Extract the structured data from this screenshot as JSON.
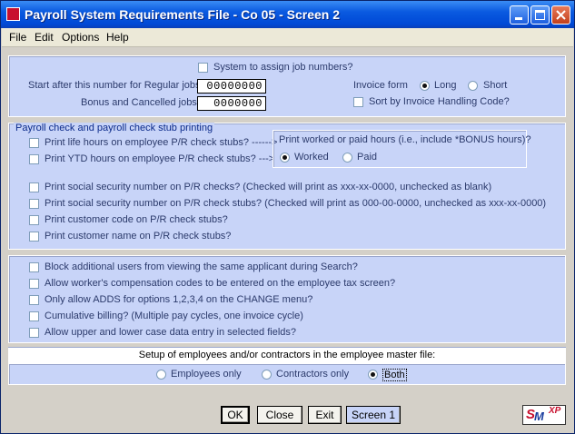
{
  "window": {
    "title": "Payroll System Requirements File - Co 05 - Screen 2"
  },
  "menu": [
    "File",
    "Edit",
    "Options",
    "Help"
  ],
  "top": {
    "assign_job_numbers": "System to assign job numbers?",
    "start_regular_label": "Start after this number for Regular jobs",
    "start_regular_value": "00000000",
    "bonus_label": "Bonus and Cancelled jobs",
    "bonus_value": "0000000",
    "invoice_form_label": "Invoice form",
    "invoice_long": "Long",
    "invoice_short": "Short",
    "sort_invoice": "Sort by Invoice Handling Code?"
  },
  "check": {
    "header": "Payroll check and payroll check stub printing",
    "life_hours": "Print life hours on employee P/R check stubs? ------>",
    "ytd_hours": "Print YTD hours on employee P/R check stubs? --->",
    "worked_paid_q": "Print worked or paid hours (i.e., include *BONUS hours)?",
    "worked": "Worked",
    "paid": "Paid",
    "ssn_checks": "Print social security number on P/R checks?  (Checked will print as xxx-xx-0000, unchecked as blank)",
    "ssn_stubs": "Print social security number on P/R check stubs?  (Checked will print as 000-00-0000, unchecked as xxx-xx-0000)",
    "customer_code": "Print customer code on P/R check stubs?",
    "customer_name": "Print customer name on P/R check stubs?"
  },
  "misc": [
    "Block additional users from viewing the same applicant during Search?",
    "Allow worker's compensation codes to be entered on the employee tax screen?",
    "Only allow ADDS for options 1,2,3,4 on the CHANGE menu?",
    "Cumulative billing? (Multiple pay cycles, one invoice cycle)",
    "Allow upper and lower case data entry in selected fields?"
  ],
  "setup": {
    "header": "Setup of employees and/or contractors in the employee master file:",
    "employees_only": "Employees only",
    "contractors_only": "Contractors only",
    "both": "Both"
  },
  "buttons": {
    "ok": "OK",
    "close": "Close",
    "exit": "Exit",
    "screen1": "Screen 1"
  },
  "logo": {
    "s": "S",
    "m": "M",
    "xp": "XP"
  }
}
